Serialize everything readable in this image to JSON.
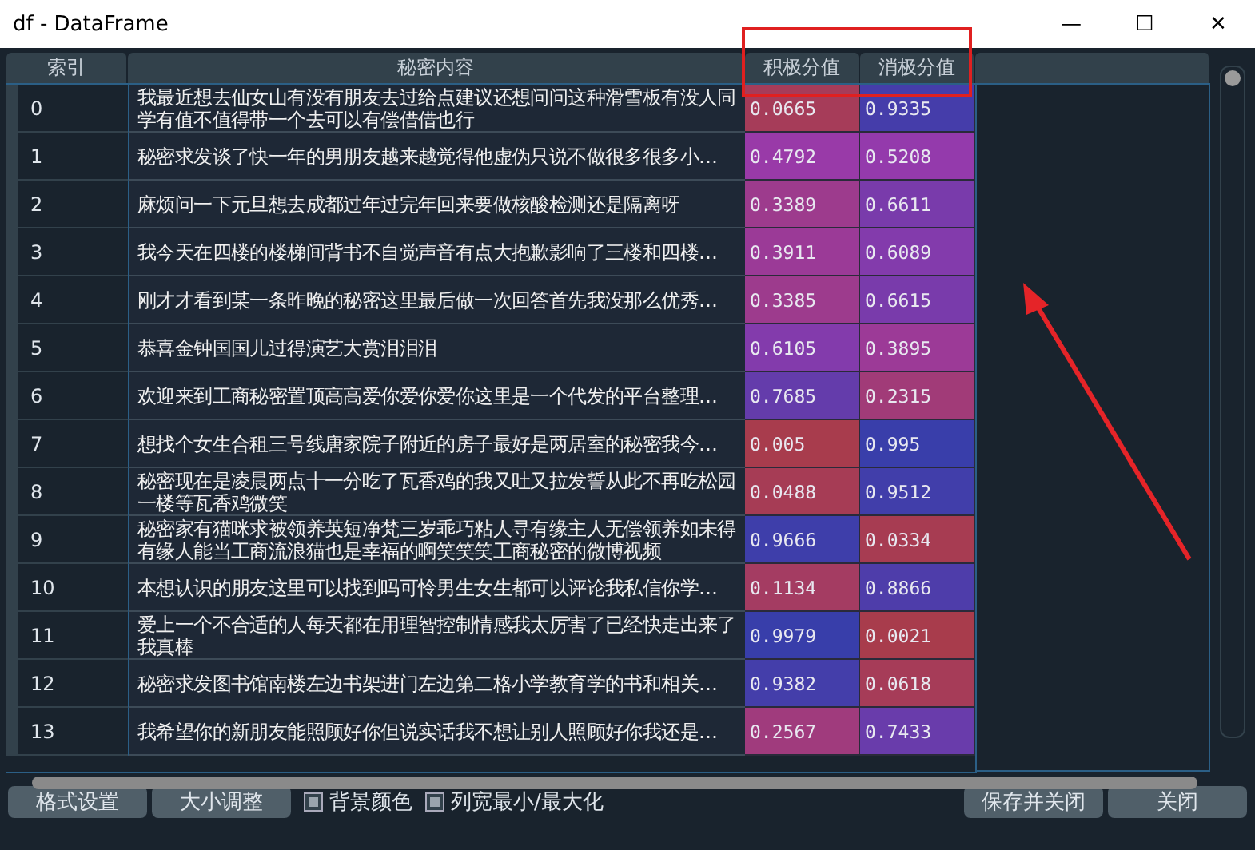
{
  "window": {
    "title": "df - DataFrame",
    "controls": [
      "—",
      "☐",
      "✕"
    ]
  },
  "table": {
    "columns": [
      "索引",
      "秘密内容",
      "积极分值",
      "消极分值"
    ],
    "rows": [
      {
        "index": "0",
        "content": "我最近想去仙女山有没有朋友去过给点建议还想问问这种滑雪板有没人同学有值不值得带一个去可以有偿借借也行",
        "positive": "0.0665",
        "negative": "0.9335"
      },
      {
        "index": "1",
        "content": "秘密求发谈了快一年的男朋友越来越觉得他虚伪只说不做很多很多小…",
        "positive": "0.4792",
        "negative": "0.5208"
      },
      {
        "index": "2",
        "content": "麻烦问一下元旦想去成都过年过完年回来要做核酸检测还是隔离呀",
        "positive": "0.3389",
        "negative": "0.6611"
      },
      {
        "index": "3",
        "content": "我今天在四楼的楼梯间背书不自觉声音有点大抱歉影响了三楼和四楼…",
        "positive": "0.3911",
        "negative": "0.6089"
      },
      {
        "index": "4",
        "content": "刚才才看到某一条昨晚的秘密这里最后做一次回答首先我没那么优秀…",
        "positive": "0.3385",
        "negative": "0.6615"
      },
      {
        "index": "5",
        "content": "恭喜金钟国国儿过得演艺大赏泪泪泪",
        "positive": "0.6105",
        "negative": "0.3895"
      },
      {
        "index": "6",
        "content": "欢迎来到工商秘密置顶高高爱你爱你爱你这里是一个代发的平台整理…",
        "positive": "0.7685",
        "negative": "0.2315"
      },
      {
        "index": "7",
        "content": "想找个女生合租三号线唐家院子附近的房子最好是两居室的秘密我今…",
        "positive": "0.005",
        "negative": "0.995"
      },
      {
        "index": "8",
        "content": "秘密现在是凌晨两点十一分吃了瓦香鸡的我又吐又拉发誓从此不再吃松园一楼等瓦香鸡微笑",
        "positive": "0.0488",
        "negative": "0.9512"
      },
      {
        "index": "9",
        "content": "秘密家有猫咪求被领养英短净梵三岁乖巧粘人寻有缘主人无偿领养如未得有缘人能当工商流浪猫也是幸福的啊笑笑笑工商秘密的微博视频",
        "positive": "0.9666",
        "negative": "0.0334"
      },
      {
        "index": "10",
        "content": "本想认识的朋友这里可以找到吗可怜男生女生都可以评论我私信你学…",
        "positive": "0.1134",
        "negative": "0.8866"
      },
      {
        "index": "11",
        "content": "爱上一个不合适的人每天都在用理智控制情感我太厉害了已经快走出来了我真棒",
        "positive": "0.9979",
        "negative": "0.0021"
      },
      {
        "index": "12",
        "content": "秘密求发图书馆南楼左边书架进门左边第二格小学教育学的书和相关…",
        "positive": "0.9382",
        "negative": "0.0618"
      },
      {
        "index": "13",
        "content": "我希望你的新朋友能照顾好你但说实话我不想让别人照顾好你我还是…",
        "positive": "0.2567",
        "negative": "0.7433"
      }
    ]
  },
  "footer": {
    "buttons": [
      "格式设置",
      "大小调整"
    ],
    "checkboxes": [
      {
        "label": "背景颜色",
        "checked": true
      },
      {
        "label": "列宽最小/最大化",
        "checked": true
      }
    ],
    "right_buttons": [
      "保存并关闭",
      "关闭"
    ]
  }
}
